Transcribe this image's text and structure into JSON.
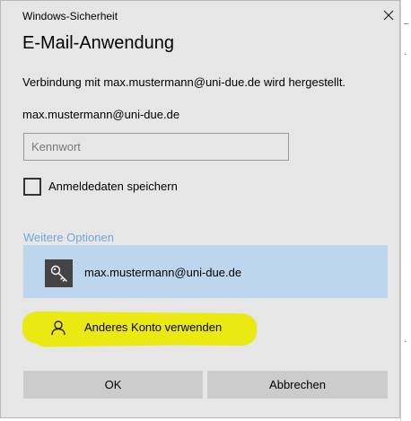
{
  "window": {
    "title": "Windows-Sicherheit"
  },
  "dialog": {
    "heading": "E-Mail-Anwendung",
    "message": "Verbindung mit max.mustermann@uni-due.de wird hergestellt.",
    "account": "max.mustermann@uni-due.de",
    "password_placeholder": "Kennwort",
    "password_value": "",
    "remember_label": "Anmeldedaten speichern",
    "remember_checked": false,
    "more_options_label": "Weitere Optionen",
    "options": [
      {
        "label": "max.mustermann@uni-due.de",
        "icon": "key-icon",
        "selected": true
      },
      {
        "label": "Anderes Konto verwenden",
        "icon": "person-icon",
        "selected": false,
        "highlight_color": "#eaea12"
      }
    ],
    "ok_label": "OK",
    "cancel_label": "Abbrechen"
  },
  "colors": {
    "dialog_bg": "#e6e6e6",
    "selected_option_bg": "#bcd6ee",
    "link": "#6fa8dc",
    "button_bg": "#cccccc",
    "highlight": "#eaea12"
  }
}
